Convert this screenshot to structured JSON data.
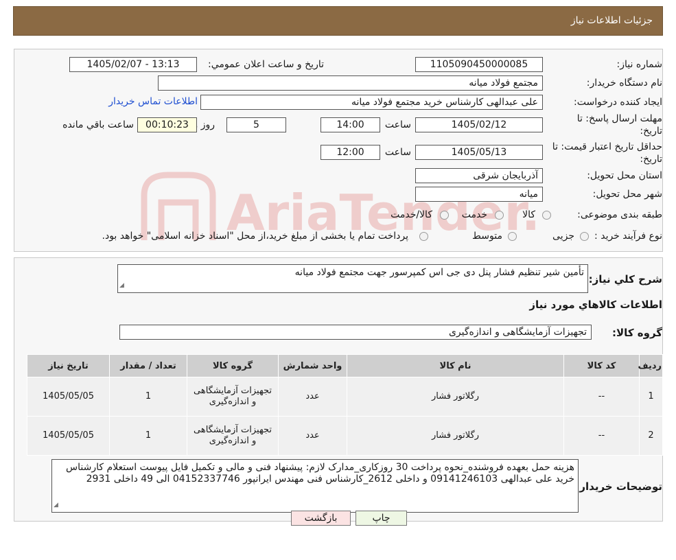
{
  "header": {
    "title": "جزئیات اطلاعات نیاز"
  },
  "form": {
    "need_number_label": "شماره نیاز:",
    "need_number": "1105090450000085",
    "announce_label": "تاریخ و ساعت اعلان عمومي:",
    "announce_value": "1405/02/07 - 13:13",
    "buyer_org_label": "نام دستگاه خریدار:",
    "buyer_org": "مجتمع فولاد میانه",
    "requester_label": "ایجاد کننده درخواست:",
    "requester": "علی عبدالهی کارشناس خرید مجتمع فولاد میانه",
    "contact_link": "اطلاعات تماس خریدار",
    "deadline_label_1": "مهلت ارسال پاسخ: تا",
    "deadline_label_2": "تاریخ:",
    "deadline_date": "1405/02/12",
    "time_label": "ساعت",
    "deadline_time": "14:00",
    "days_value": "5",
    "days_label": "روز و",
    "remaining_time": "00:10:23",
    "remaining_label": "ساعت باقي مانده",
    "validity_label_1": "حداقل تاریخ اعتبار قیمت: تا",
    "validity_label_2": "تاریخ:",
    "validity_date": "1405/05/13",
    "validity_time": "12:00",
    "province_label": "استان محل تحویل:",
    "province": "آذربایجان شرقی",
    "city_label": "شهر محل تحویل:",
    "city": "میانه",
    "category_label": "طبقه بندی موضوعی:",
    "category_options": [
      "کالا",
      "خدمت",
      "کالا/خدمت"
    ],
    "process_label": "نوع فرآیند خرید :",
    "process_options": [
      "جزیی",
      "متوسط"
    ],
    "process_note": "پرداخت تمام یا بخشی از مبلغ خرید،از محل \"اسناد خزانه اسلامی\" خواهد بود."
  },
  "details": {
    "summary_label": "شرح کلي نیاز:",
    "summary": "تأمین شیر تنظیم فشار پنل دی جی اس کمپرسور جهت مجتمع فولاد میانه",
    "goods_info_title": "اطلاعات کالاهاي مورد نیاز",
    "goods_group_label": "گروه کالا:",
    "goods_group": "تجهیزات آزمایشگاهی و اندازه‌گیری"
  },
  "table": {
    "headers": [
      "ردیف",
      "کد کالا",
      "نام کالا",
      "واحد شمارش",
      "گروه کالا",
      "تعداد / مقدار",
      "تاریخ نیاز"
    ],
    "rows": [
      [
        "1",
        "--",
        "رگلاتور فشار",
        "عدد",
        "تجهیزات آزمایشگاهی و اندازه‌گیری",
        "1",
        "1405/05/05"
      ],
      [
        "2",
        "--",
        "رگلاتور فشار",
        "عدد",
        "تجهیزات آزمایشگاهی و اندازه‌گیری",
        "1",
        "1405/05/05"
      ]
    ]
  },
  "buyer_notes": {
    "label": "توضیحات خریدار:",
    "text": "هزینه حمل بعهده فروشنده_نحوه پرداخت 30 روزکاری_مدارک لازم: پیشنهاد فنی و مالی و تکمیل فایل پیوست استعلام کارشناس خرید علی عبدالهی 09141246103 و داخلی 2612_کارشناس فنی مهندس ایرانپور 04152337746 الی 49 داخلی 2931"
  },
  "buttons": {
    "print": "چاپ",
    "back": "بازگشت"
  },
  "watermark": {
    "text": "AriaTender.neT"
  },
  "colors": {
    "header_bg": "#8b6a44",
    "link": "#1f4fd1",
    "back_btn_bg": "#fbe3e3",
    "print_btn_bg": "#eef7e4",
    "watermark": "#d9534f"
  }
}
